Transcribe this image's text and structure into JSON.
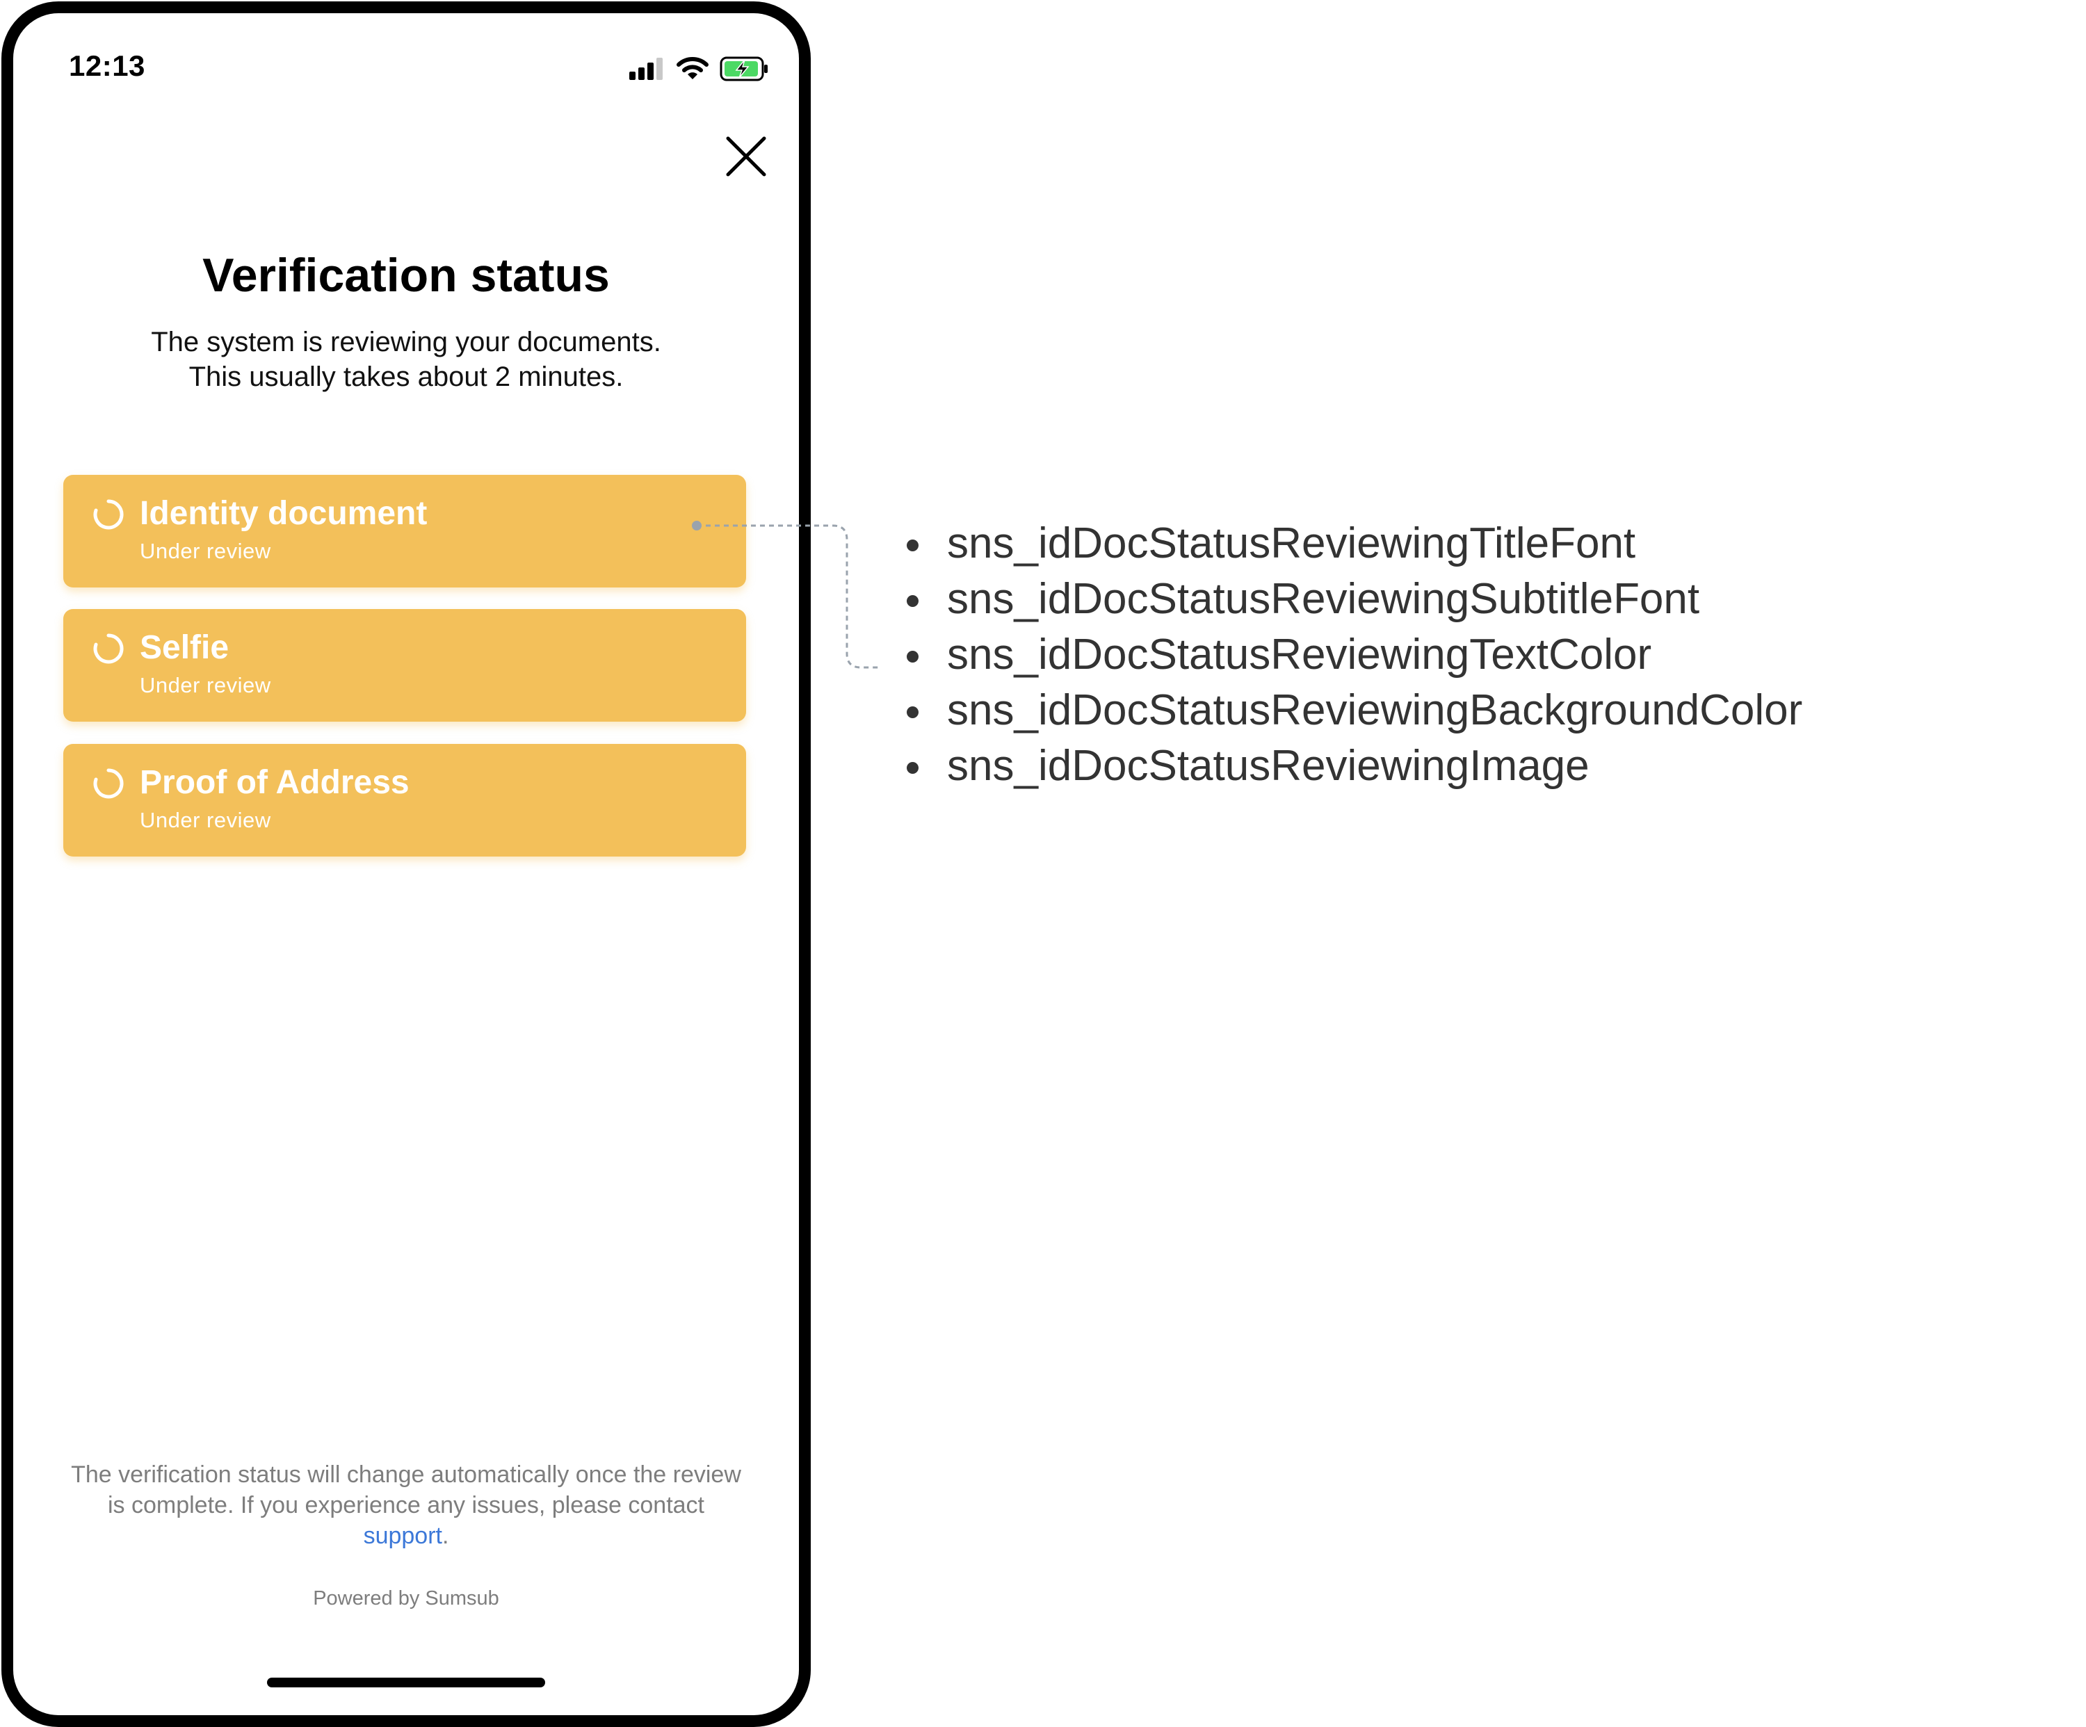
{
  "status_bar": {
    "time": "12:13"
  },
  "header": {
    "title": "Verification status"
  },
  "subtitle": {
    "line1": "The system is reviewing your documents.",
    "line2": "This usually takes about 2 minutes."
  },
  "documents": [
    {
      "title": "Identity document",
      "status": "Under review"
    },
    {
      "title": "Selfie",
      "status": "Under review"
    },
    {
      "title": "Proof of Address",
      "status": "Under review"
    }
  ],
  "footer": {
    "note_before_link": "The verification status will change automatically once the review is complete. If you experience any issues, please contact ",
    "link_label": "support",
    "note_after_link": ".",
    "powered_by": "Powered by Sumsub"
  },
  "customization_keys": [
    "sns_idDocStatusReviewingTitleFont",
    "sns_idDocStatusReviewingSubtitleFont",
    "sns_idDocStatusReviewingTextColor",
    "sns_idDocStatusReviewingBackgroundColor",
    "sns_idDocStatusReviewingImage"
  ],
  "colors": {
    "card_background": "#f3c05a",
    "link": "#3c78d8",
    "battery_fill": "#4cd964"
  },
  "icons": {
    "close": "close-icon",
    "spinner": "spinner-icon",
    "signal": "signal-icon",
    "wifi": "wifi-icon",
    "battery": "battery-charging-icon"
  }
}
